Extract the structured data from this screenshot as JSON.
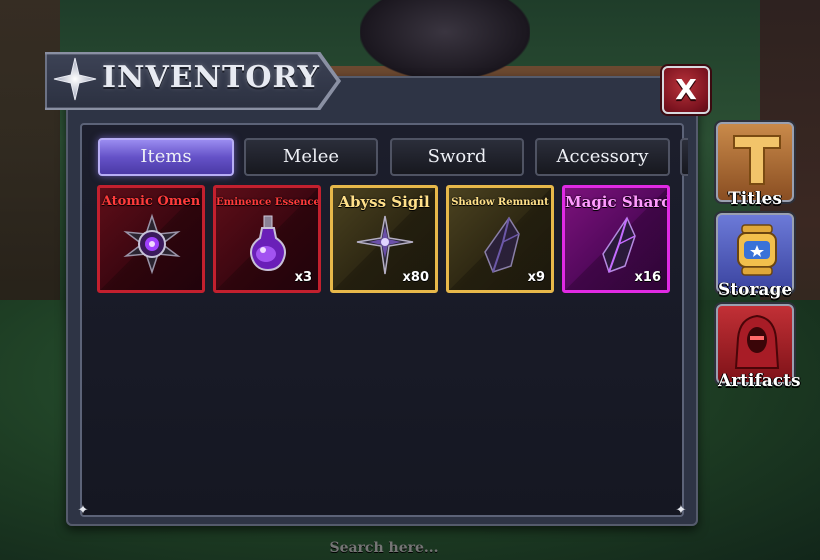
{
  "title": "INVENTORY",
  "close_label": "X",
  "tabs": [
    {
      "label": "Items",
      "active": true
    },
    {
      "label": "Melee",
      "active": false
    },
    {
      "label": "Sword",
      "active": false
    },
    {
      "label": "Accessory",
      "active": false
    }
  ],
  "items": [
    {
      "name": "Atomic Omen",
      "count": "",
      "rarity": "red",
      "name_color": "#ff3b3b",
      "icon": "dark-sigil-icon"
    },
    {
      "name": "Eminence Essence",
      "count": "x3",
      "rarity": "red",
      "name_color": "#ff3b3b",
      "icon": "purple-potion-icon"
    },
    {
      "name": "Abyss Sigil",
      "count": "x80",
      "rarity": "gold",
      "name_color": "#ffe08a",
      "icon": "abyss-star-icon"
    },
    {
      "name": "Shadow Remnant",
      "count": "x9",
      "rarity": "gold",
      "name_color": "#ffe08a",
      "icon": "shadow-crystal-icon"
    },
    {
      "name": "Magic Shard",
      "count": "x16",
      "rarity": "purple",
      "name_color": "#ff9bff",
      "icon": "magic-crystal-icon"
    }
  ],
  "side_buttons": [
    {
      "label": "Titles",
      "icon": "title-letter-t-icon"
    },
    {
      "label": "Storage",
      "icon": "storage-capsule-icon"
    },
    {
      "label": "Artifacts",
      "icon": "hooded-figure-icon"
    }
  ],
  "search": {
    "placeholder": "Search here..."
  },
  "colors": {
    "accent": "#6552c8",
    "red_rarity": "#c3202e",
    "gold_rarity": "#e7b84a",
    "purple_rarity": "#e02ae4"
  }
}
